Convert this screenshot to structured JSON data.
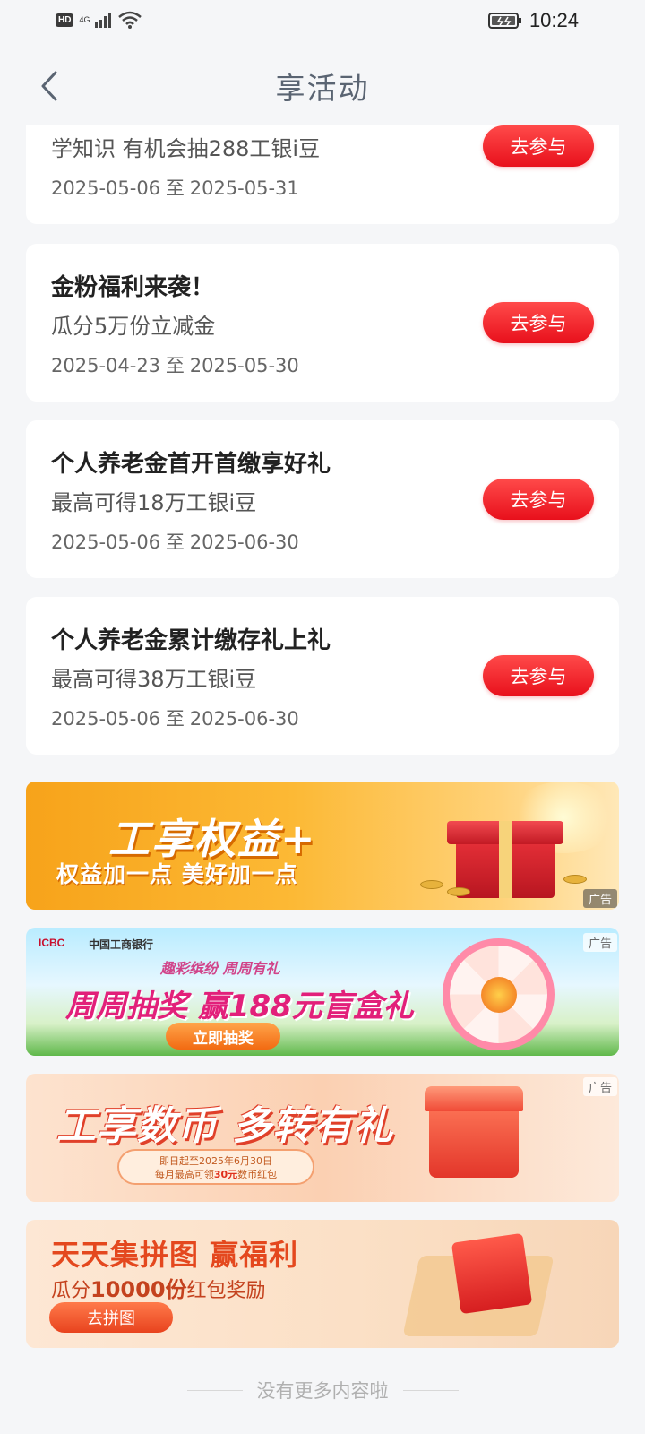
{
  "status_bar": {
    "hd_label": "HD",
    "network_label": "4G",
    "time": "10:24"
  },
  "header": {
    "title": "享活动"
  },
  "activities": [
    {
      "subtitle": "学知识 有机会抽288工银i豆",
      "date_start": "2025-05-06",
      "date_sep": "至",
      "date_end": "2025-05-31",
      "button_label": "去参与"
    },
    {
      "title": "金粉福利来袭！",
      "subtitle": "瓜分5万份立减金",
      "date_start": "2025-04-23",
      "date_sep": "至",
      "date_end": "2025-05-30",
      "button_label": "去参与"
    },
    {
      "title": "个人养老金首开首缴享好礼",
      "subtitle": "最高可得18万工银i豆",
      "date_start": "2025-05-06",
      "date_sep": "至",
      "date_end": "2025-06-30",
      "button_label": "去参与"
    },
    {
      "title": "个人养老金累计缴存礼上礼",
      "subtitle": "最高可得38万工银i豆",
      "date_start": "2025-05-06",
      "date_sep": "至",
      "date_end": "2025-06-30",
      "button_label": "去参与"
    }
  ],
  "banners": [
    {
      "headline": "工享权益+",
      "subline": "权益加一点 美好加一点",
      "ad_label": "广告"
    },
    {
      "brand": "ICBC",
      "bank_name": "中国工商银行",
      "slogan": "趣彩缤纷 周周有礼",
      "headline": "周周抽奖 赢188元盲盒礼",
      "cta": "立即抽奖",
      "ad_label": "广告"
    },
    {
      "headline": "工享数币 多转有礼",
      "pill_line1": "即日起至2025年6月30日",
      "pill_line2_a": "每月最高可领",
      "pill_line2_b": "30元",
      "pill_line2_c": "数币红包",
      "ad_label": "广告"
    },
    {
      "headline": "天天集拼图 赢福利",
      "sub_a": "瓜分",
      "sub_b": "10000份",
      "sub_c": "红包奖励",
      "cta": "去拼图"
    }
  ],
  "footer": {
    "text": "没有更多内容啦"
  },
  "colors": {
    "accent_red": "#e8101c",
    "background": "#f5f6f8",
    "title_gray": "#5a6472"
  }
}
